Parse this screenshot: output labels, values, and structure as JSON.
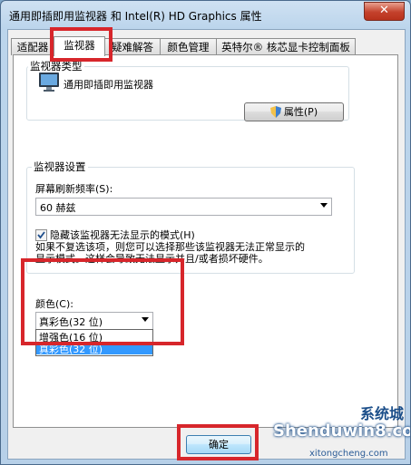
{
  "window": {
    "title": "通用即插即用监视器 和 Intel(R) HD Graphics 属性",
    "close_label": "✕"
  },
  "tabs": [
    {
      "label": "适配器",
      "active": false
    },
    {
      "label": "监视器",
      "active": true
    },
    {
      "label": "疑难解答",
      "active": false
    },
    {
      "label": "颜色管理",
      "active": false
    },
    {
      "label": "英特尔® 核芯显卡控制面板",
      "active": false
    }
  ],
  "monitor_type": {
    "group_label": "监视器类型",
    "name": "通用即插即用监视器",
    "properties_button": "属性(P)"
  },
  "monitor_settings": {
    "group_label": "监视器设置",
    "refresh_label": "屏幕刷新频率(S):",
    "refresh_value": "60 赫兹",
    "hide_modes_checkbox": "隐藏该监视器无法显示的模式(H)",
    "hide_modes_checked": true,
    "description_line1": "如果不复选该项，则您可以选择那些该监视器无法正常显示的",
    "description_line2": "显示模式。这样会导致无法显示并且/或者损坏硬件。"
  },
  "colors": {
    "label": "颜色(C):",
    "selected": "真彩色(32 位)",
    "options": [
      "增强色(16 位)",
      "真彩色(32 位)"
    ],
    "highlighted_index": 1
  },
  "footer": {
    "ok_button": "确定"
  },
  "watermark": {
    "main": "Shenduwin8.com",
    "cn": "系统城",
    "sub": "xitongcheng.com"
  },
  "colors_theme": {
    "accent": "#d7262b",
    "selection": "#3399ff"
  }
}
